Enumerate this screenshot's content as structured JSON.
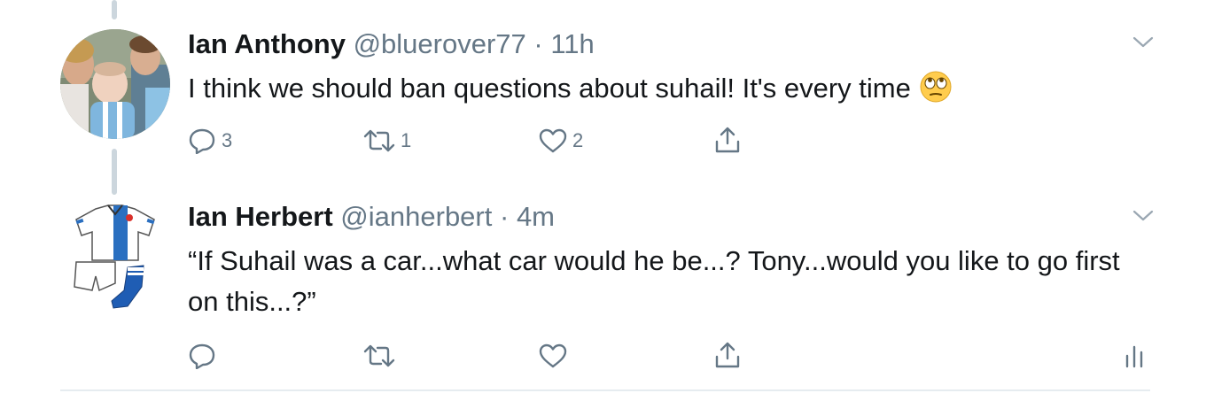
{
  "tweets": [
    {
      "name": "Ian Anthony",
      "handle": "@bluerover77",
      "separator": "·",
      "time": "11h",
      "text": "I think we should ban questions about suhail! It's every time",
      "emoji": "face-with-rolling-eyes",
      "replies": "3",
      "retweets": "1",
      "likes": "2"
    },
    {
      "name": "Ian Herbert",
      "handle": "@ianherbert",
      "separator": "·",
      "time": "4m",
      "text": "“If Suhail was a car...what car would he be...? Tony...would you like to go first on this...?”",
      "replies": "",
      "retweets": "",
      "likes": ""
    }
  ],
  "colors": {
    "text": "#14171a",
    "muted": "#657786",
    "thread_line": "#ccd6dd",
    "divider": "#e6ecf0"
  }
}
